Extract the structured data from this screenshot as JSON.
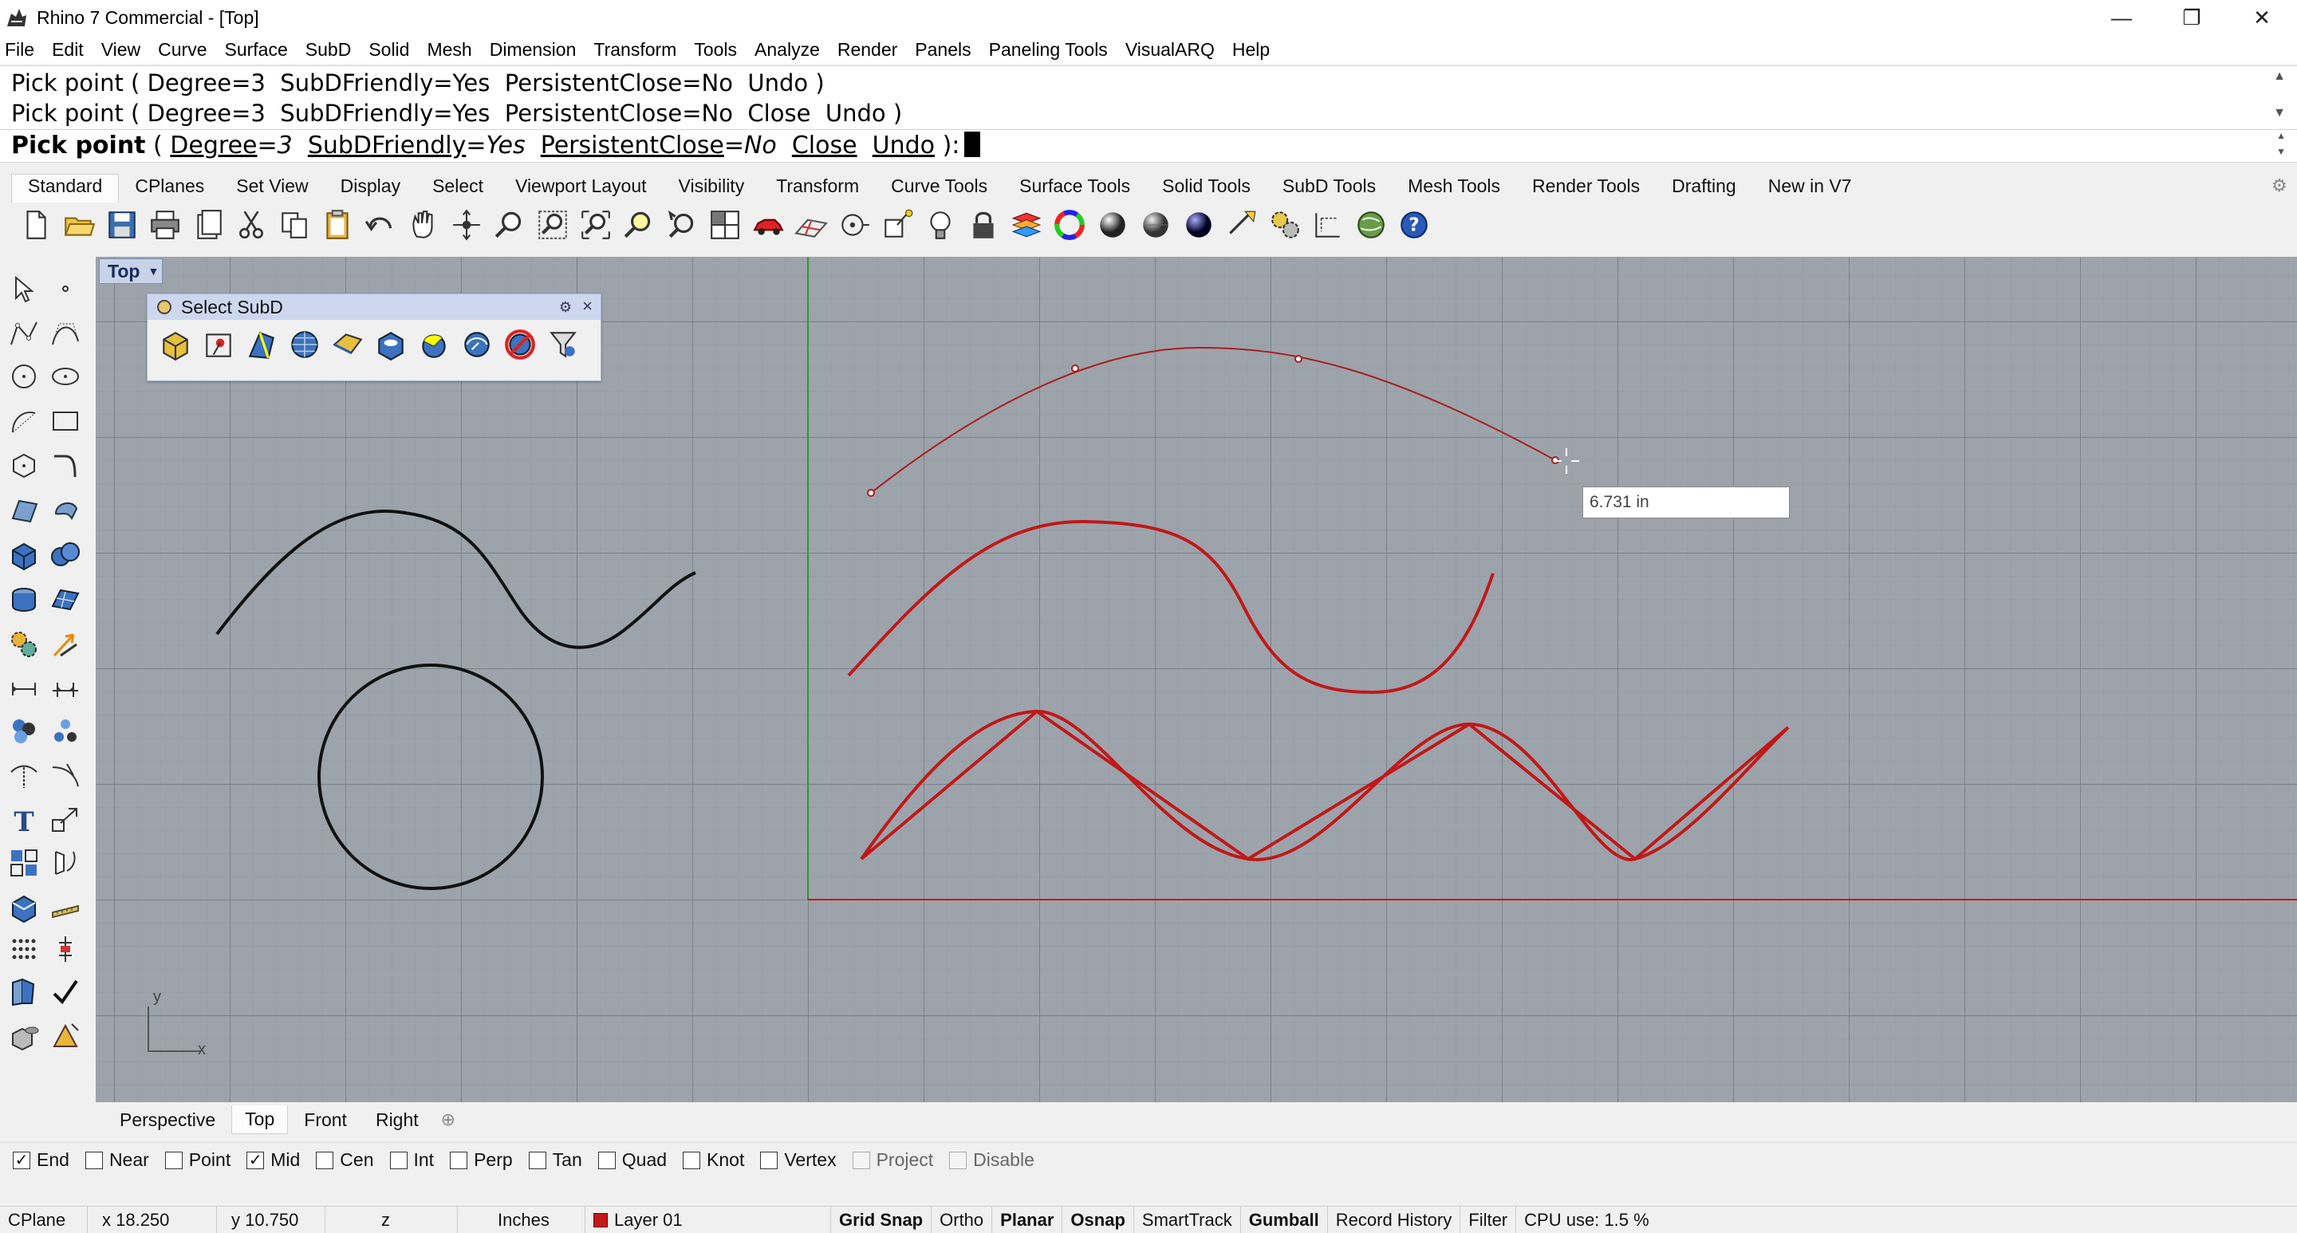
{
  "window": {
    "title": "Rhino 7 Commercial - [Top]",
    "minimize": "—",
    "restore": "❐",
    "close": "✕"
  },
  "menu": [
    "File",
    "Edit",
    "View",
    "Curve",
    "Surface",
    "SubD",
    "Solid",
    "Mesh",
    "Dimension",
    "Transform",
    "Tools",
    "Analyze",
    "Render",
    "Panels",
    "Paneling Tools",
    "VisualARQ",
    "Help"
  ],
  "command": {
    "history": [
      "Pick point ( Degree=3  SubDFriendly=Yes  PersistentClose=No  Undo )",
      "Pick point ( Degree=3  SubDFriendly=Yes  PersistentClose=No  Close  Undo )"
    ],
    "prompt_label": "Pick point",
    "prompt_open": " ( ",
    "opt_degree": "Degree",
    "eq1": "=",
    "val_degree": "3",
    "opt_subd": "SubDFriendly",
    "eq2": "=",
    "val_subd": "Yes",
    "opt_persist": "PersistentClose",
    "eq3": "=",
    "val_persist": "No",
    "opt_close": "Close",
    "opt_undo": "Undo",
    "prompt_close": " ):"
  },
  "toolbar_tabs": [
    "Standard",
    "CPlanes",
    "Set View",
    "Display",
    "Select",
    "Viewport Layout",
    "Visibility",
    "Transform",
    "Curve Tools",
    "Surface Tools",
    "Solid Tools",
    "SubD Tools",
    "Mesh Tools",
    "Render Tools",
    "Drafting",
    "New in V7"
  ],
  "active_tab": "Standard",
  "viewport": {
    "name": "Top",
    "floating_toolbar_title": "Select SubD",
    "distance_readout": "6.731 in",
    "axis_x": "x",
    "axis_y": "y"
  },
  "viewport_tabs": [
    "Perspective",
    "Top",
    "Front",
    "Right"
  ],
  "active_viewport_tab": "Top",
  "osnaps": [
    {
      "label": "End",
      "checked": true
    },
    {
      "label": "Near",
      "checked": false
    },
    {
      "label": "Point",
      "checked": false
    },
    {
      "label": "Mid",
      "checked": true
    },
    {
      "label": "Cen",
      "checked": false
    },
    {
      "label": "Int",
      "checked": false
    },
    {
      "label": "Perp",
      "checked": false
    },
    {
      "label": "Tan",
      "checked": false
    },
    {
      "label": "Quad",
      "checked": false
    },
    {
      "label": "Knot",
      "checked": false
    },
    {
      "label": "Vertex",
      "checked": false
    },
    {
      "label": "Project",
      "checked": false,
      "disabled": true
    },
    {
      "label": "Disable",
      "checked": false,
      "disabled": true
    }
  ],
  "status": {
    "cplane": "CPlane",
    "x": "x 18.250",
    "y": "y 10.750",
    "z": "z",
    "units": "Inches",
    "layer": "Layer 01",
    "layer_color": "#c21a1a",
    "grid_snap": "Grid Snap",
    "ortho": "Ortho",
    "planar": "Planar",
    "osnap": "Osnap",
    "smarttrack": "SmartTrack",
    "gumball": "Gumball",
    "record_history": "Record History",
    "filter": "Filter",
    "cpu": "CPU use: 1.5 %"
  },
  "colors": {
    "viewport_bg": "#9da3ab",
    "curve_black": "#111111",
    "curve_red": "#c01818",
    "axis_green": "#2f9a2f",
    "axis_red": "#c41a1a"
  }
}
